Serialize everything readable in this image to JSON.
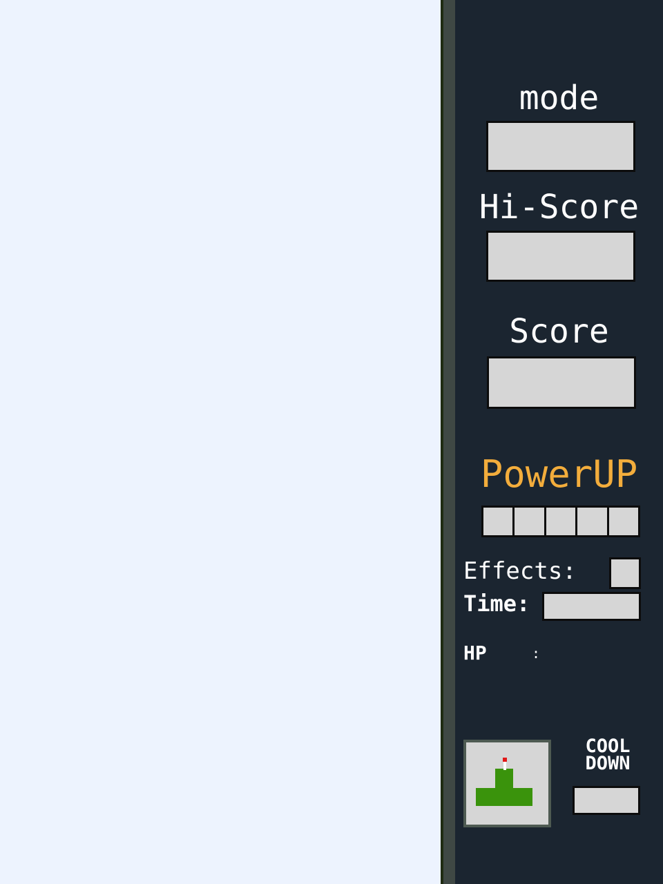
{
  "colors": {
    "playfield": "#edf3fe",
    "panel": "#1b2530",
    "slot_fill": "#d6d6d6",
    "powerup_label": "#f3ad3c",
    "turret": "#3a930c",
    "turret_tip": "#e11919"
  },
  "sidebar": {
    "mode_label": "mode",
    "mode_value": "",
    "hiscore_label": "Hi-Score",
    "hiscore_value": "",
    "score_label": "Score",
    "score_value": "",
    "powerup_label": "PowerUP",
    "powerup_slots": [
      "",
      "",
      "",
      "",
      ""
    ],
    "effects_label": "Effects:",
    "effects_value": "",
    "time_label": "Time:",
    "time_value": "",
    "hp_label": "HP",
    "hp_separator": ":",
    "cooldown_label": "COOL DOWN",
    "cooldown_value": "",
    "selected_unit_icon": "turret-icon"
  }
}
